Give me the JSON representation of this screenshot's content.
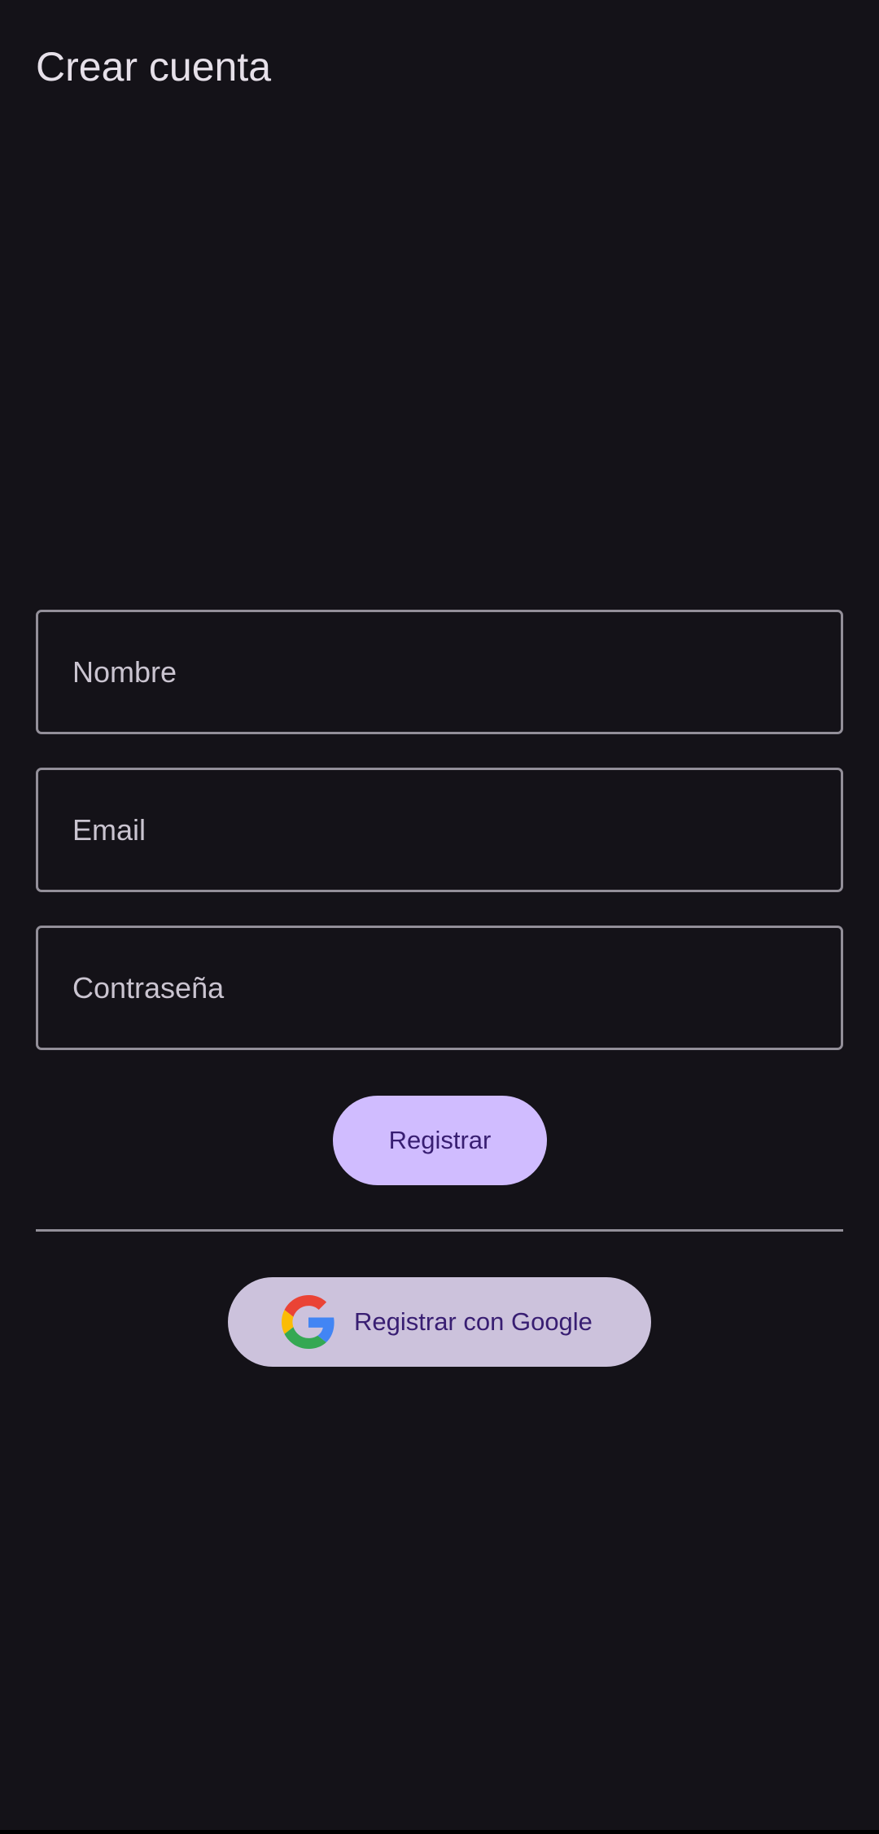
{
  "header": {
    "title": "Crear cuenta"
  },
  "form": {
    "name_placeholder": "Nombre",
    "email_placeholder": "Email",
    "password_placeholder": "Contraseña",
    "register_label": "Registrar",
    "google_label": "Registrar con Google"
  },
  "icons": {
    "google": "google-logo-icon"
  },
  "colors": {
    "background": "#141218",
    "primary": "#D0BCFF",
    "on_primary": "#381E72",
    "secondary_container": "#CCC2DC",
    "outline": "#938F99",
    "on_surface": "#E6E0E9"
  }
}
